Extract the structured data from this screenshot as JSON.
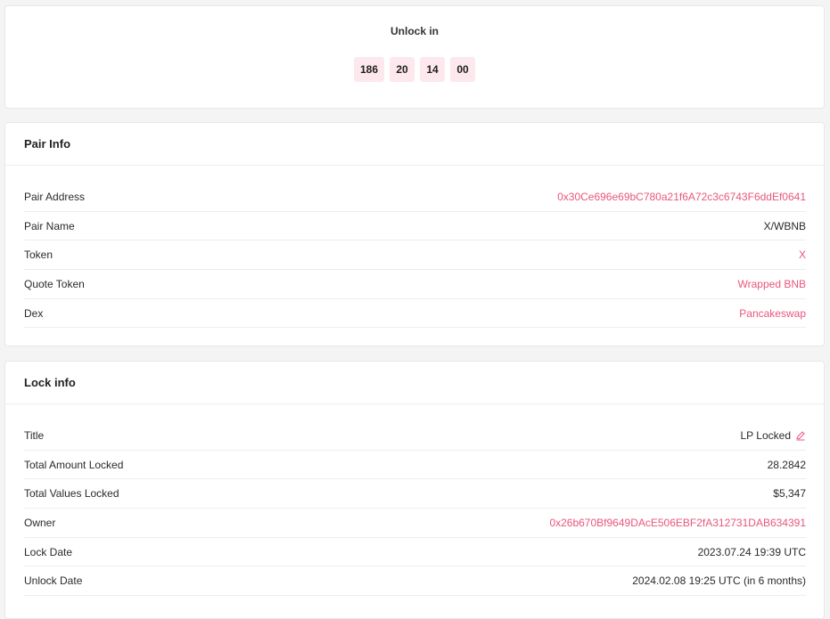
{
  "unlock": {
    "title": "Unlock in",
    "countdown": [
      "186",
      "20",
      "14",
      "00"
    ]
  },
  "pair_info": {
    "title": "Pair Info",
    "rows": [
      {
        "label": "Pair Address",
        "value": "0x30Ce696e69bC780a21f6A72c3c6743F6ddEf0641"
      },
      {
        "label": "Pair Name",
        "value": "X/WBNB"
      },
      {
        "label": "Token",
        "value": "X"
      },
      {
        "label": "Quote Token",
        "value": "Wrapped BNB"
      },
      {
        "label": "Dex",
        "value": "Pancakeswap"
      }
    ]
  },
  "lock_info": {
    "title": "Lock info",
    "rows": [
      {
        "label": "Title",
        "value": "LP Locked"
      },
      {
        "label": "Total Amount Locked",
        "value": "28.2842"
      },
      {
        "label": "Total Values Locked",
        "value": "$5,347"
      },
      {
        "label": "Owner",
        "value": "0x26b670Bf9649DAcE506EBF2fA312731DAB634391"
      },
      {
        "label": "Lock Date",
        "value": "2023.07.24 19:39 UTC"
      },
      {
        "label": "Unlock Date",
        "value": "2024.02.08 19:25 UTC (in 6 months)"
      }
    ]
  },
  "colors": {
    "accent": "#e8577e",
    "countdown_bg": "#fde8ee",
    "page_bg": "#f4f4f5"
  },
  "icons": {
    "edit": "pencil-icon"
  }
}
